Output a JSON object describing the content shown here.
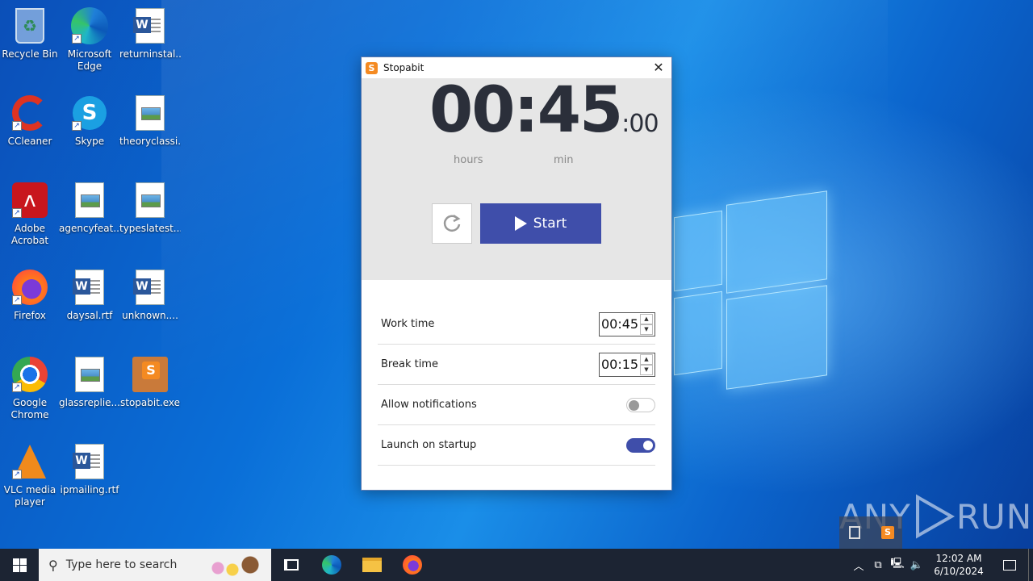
{
  "desktop": {
    "icons": [
      {
        "label": "Recycle Bin"
      },
      {
        "label": "Microsoft Edge"
      },
      {
        "label": "returninstal..."
      },
      {
        "label": "CCleaner"
      },
      {
        "label": "Skype"
      },
      {
        "label": "theoryclassi..."
      },
      {
        "label": "Adobe Acrobat"
      },
      {
        "label": "agencyfeat..."
      },
      {
        "label": "typeslatest...."
      },
      {
        "label": "Firefox"
      },
      {
        "label": "daysal.rtf"
      },
      {
        "label": "unknown...."
      },
      {
        "label": "Google Chrome"
      },
      {
        "label": "glassreplie..."
      },
      {
        "label": "stopabit.exe"
      },
      {
        "label": "VLC media player"
      },
      {
        "label": "ipmailing.rtf"
      }
    ]
  },
  "window": {
    "title": "Stopabit",
    "close_glyph": "✕",
    "logo_letter": "S"
  },
  "timer": {
    "main": "00:45",
    "seconds": ":00",
    "unit_hours": "hours",
    "unit_min": "min",
    "start_label": "Start",
    "reset_icon": "refresh-icon"
  },
  "settings": {
    "work_time_label": "Work time",
    "work_time_value": "00:45",
    "break_time_label": "Break time",
    "break_time_value": "00:15",
    "notifications_label": "Allow notifications",
    "notifications_enabled": false,
    "startup_label": "Launch on startup",
    "startup_enabled": true
  },
  "colors": {
    "accent": "#3f4eaa",
    "timer_text": "#2b2f3a",
    "panel_bg": "#e6e6e6",
    "taskbar": "#1c2433"
  },
  "watermark": {
    "text_left": "ANY",
    "text_right": "RUN"
  },
  "taskbar": {
    "search_placeholder": "Type here to search",
    "clock_time": "12:02 AM",
    "clock_date": "6/10/2024"
  }
}
